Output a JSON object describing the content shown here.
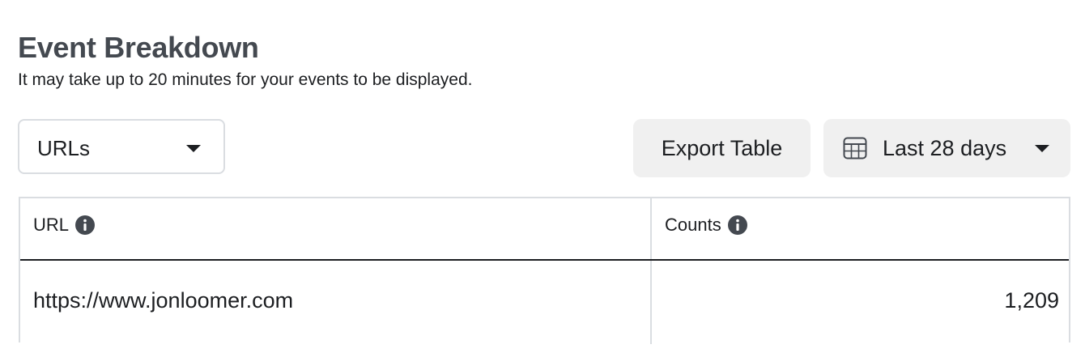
{
  "header": {
    "title": "Event Breakdown",
    "subtitle": "It may take up to 20 minutes for your events to be displayed."
  },
  "controls": {
    "breakdown_select": {
      "selected": "URLs",
      "icon": "chevron-down-icon"
    },
    "export_label": "Export Table",
    "date_range": {
      "selected": "Last 28 days",
      "icon": "calendar-icon"
    }
  },
  "table": {
    "columns": [
      {
        "label": "URL",
        "icon": "info-icon"
      },
      {
        "label": "Counts",
        "icon": "info-icon"
      }
    ],
    "rows": [
      {
        "url": "https://www.jonloomer.com",
        "count": "1,209"
      }
    ]
  }
}
